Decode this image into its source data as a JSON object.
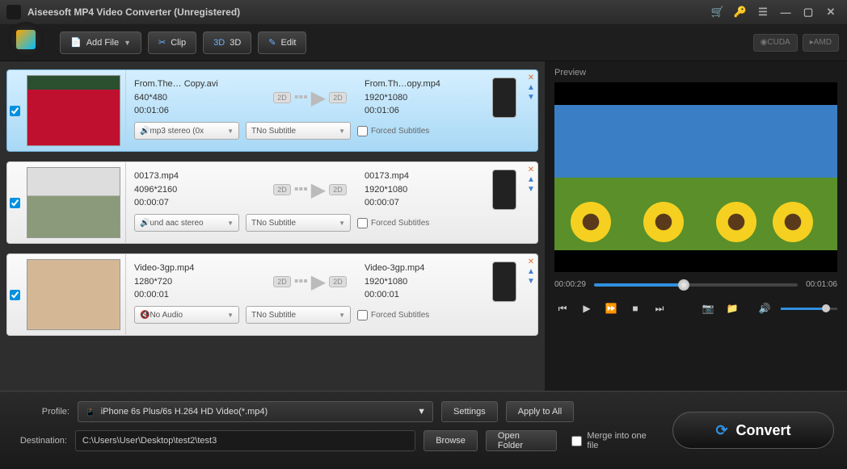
{
  "app": {
    "title": "Aiseesoft MP4 Video Converter (Unregistered)"
  },
  "toolbar": {
    "add_file": "Add File",
    "clip": "Clip",
    "three_d": "3D",
    "edit": "Edit",
    "cuda": "CUDA",
    "amd": "AMD"
  },
  "files": [
    {
      "selected": true,
      "src_name": "From.The… Copy.avi",
      "src_res": "640*480",
      "src_dur": "00:01:06",
      "out_name": "From.Th…opy.mp4",
      "out_res": "1920*1080",
      "out_dur": "00:01:06",
      "audio": "mp3 stereo (0x",
      "subtitle": "No Subtitle",
      "forced": "Forced Subtitles"
    },
    {
      "selected": false,
      "src_name": "00173.mp4",
      "src_res": "4096*2160",
      "src_dur": "00:00:07",
      "out_name": "00173.mp4",
      "out_res": "1920*1080",
      "out_dur": "00:00:07",
      "audio": "und aac stereo",
      "subtitle": "No Subtitle",
      "forced": "Forced Subtitles"
    },
    {
      "selected": false,
      "src_name": "Video-3gp.mp4",
      "src_res": "1280*720",
      "src_dur": "00:00:01",
      "out_name": "Video-3gp.mp4",
      "out_res": "1920*1080",
      "out_dur": "00:00:01",
      "audio": "No Audio",
      "subtitle": "No Subtitle",
      "forced": "Forced Subtitles"
    }
  ],
  "conv": {
    "from": "2D",
    "to": "2D"
  },
  "preview": {
    "title": "Preview",
    "time_current": "00:00:29",
    "time_total": "00:01:06",
    "progress_pct": 44
  },
  "bottom": {
    "profile_label": "Profile:",
    "profile_value": "iPhone 6s Plus/6s H.264 HD Video(*.mp4)",
    "settings": "Settings",
    "apply_all": "Apply to All",
    "dest_label": "Destination:",
    "dest_value": "C:\\Users\\User\\Desktop\\test2\\test3",
    "browse": "Browse",
    "open_folder": "Open Folder",
    "merge": "Merge into one file",
    "convert": "Convert"
  }
}
